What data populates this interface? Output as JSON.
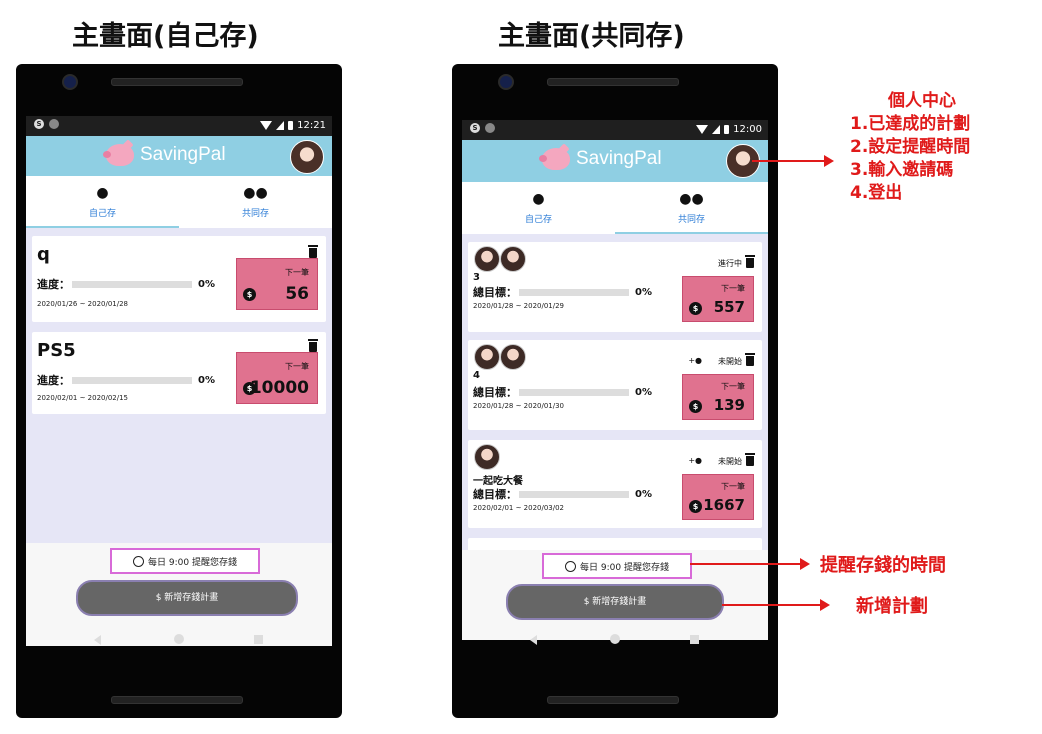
{
  "titles": {
    "left": "主畫面(自己存)",
    "right": "主畫面(共同存)"
  },
  "left_phone": {
    "status_time": "12:21",
    "status_icon": "S",
    "app_name": "SavingPal",
    "tabs": [
      {
        "icon": "person-icon",
        "label": "自己存"
      },
      {
        "icon": "group-icon",
        "label": "共同存"
      }
    ],
    "cards": [
      {
        "title": "q",
        "progress_label": "進度：",
        "progress_pct": "0%",
        "progress_value": 0,
        "dates": "2020/01/26 ~ 2020/01/28",
        "next_label": "下一筆",
        "coin": "$",
        "amount": "56"
      },
      {
        "title": "PS5",
        "progress_label": "進度：",
        "progress_pct": "0%",
        "progress_value": 0,
        "dates": "2020/02/01 ~ 2020/02/15",
        "next_label": "下一筆",
        "coin": "$",
        "amount": "10000"
      }
    ],
    "reminder": "每日  9:00  提醒您存錢",
    "add_button": "$ 新增存錢計畫"
  },
  "right_phone": {
    "status_time": "12:00",
    "status_icon": "S",
    "app_name": "SavingPal",
    "tabs": [
      {
        "icon": "person-icon",
        "label": "自己存"
      },
      {
        "icon": "group-icon",
        "label": "共同存"
      }
    ],
    "cards": [
      {
        "title": "3",
        "status": "進行中",
        "progress_label": "總目標：",
        "progress_pct": "0%",
        "progress_value": 0,
        "dates": "2020/01/28 ~ 2020/01/29",
        "next_label": "下一筆",
        "coin": "$",
        "amount": "557"
      },
      {
        "title": "4",
        "status": "未開始",
        "progress_label": "總目標：",
        "progress_pct": "0%",
        "progress_value": 0,
        "dates": "2020/01/28 ~ 2020/01/30",
        "next_label": "下一筆",
        "coin": "$",
        "amount": "139"
      },
      {
        "title": "一起吃大餐",
        "status": "未開始",
        "progress_label": "總目標：",
        "progress_pct": "0%",
        "progress_value": 0,
        "dates": "2020/02/01 ~ 2020/03/02",
        "next_label": "下一筆",
        "coin": "$",
        "amount": "1667"
      }
    ],
    "reminder": "每日  9:00  提醒您存錢",
    "add_button": "$ 新增存錢計畫"
  },
  "annotations": {
    "profile": [
      "個人中心",
      "1.已達成的計劃",
      "2.設定提醒時間",
      "3.輸入邀請碼",
      "4.登出"
    ],
    "reminder": "提醒存錢的時間",
    "add": "新增計劃"
  },
  "colors": {
    "appbar": "#8fcfe3",
    "next_box": "#e0728f",
    "annotation": "#e01a1a",
    "reminder_border": "#d86ad8"
  }
}
